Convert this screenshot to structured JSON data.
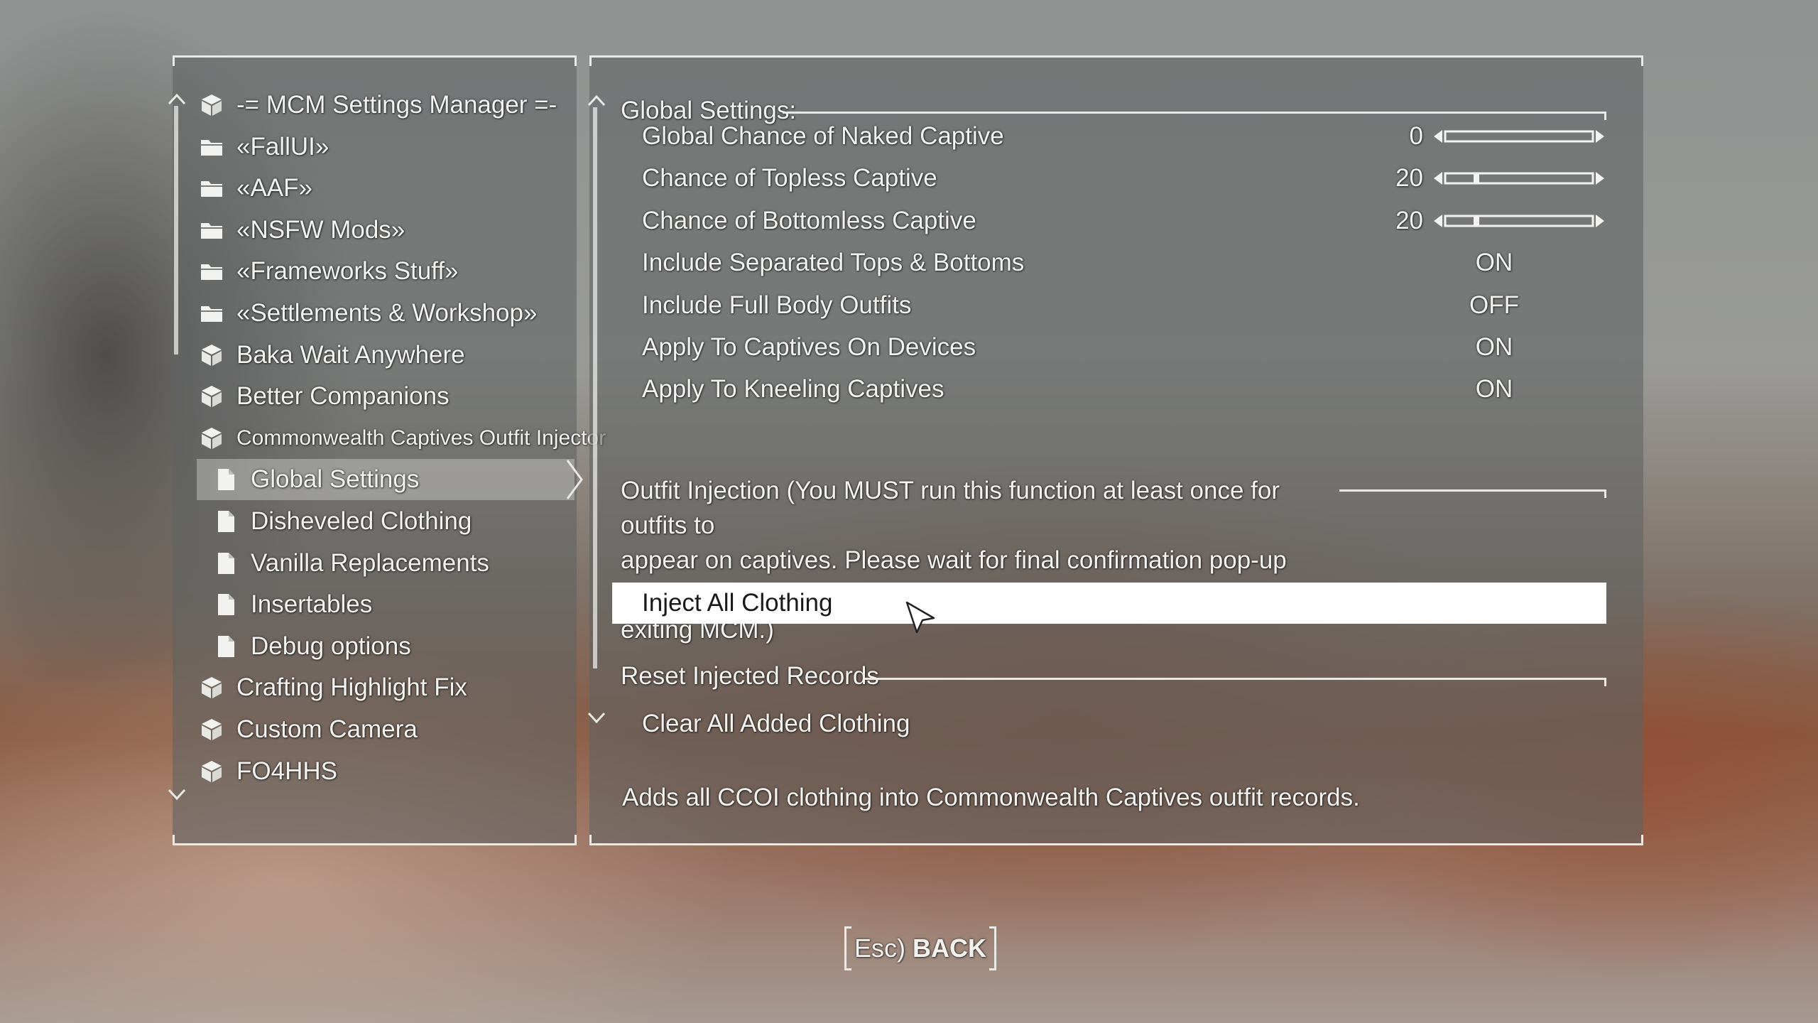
{
  "sidebar": {
    "items": [
      {
        "label": "-= MCM Settings Manager =-",
        "icon": "box-icon"
      },
      {
        "label": "«FallUI»",
        "icon": "folder-icon"
      },
      {
        "label": "«AAF»",
        "icon": "folder-icon"
      },
      {
        "label": "«NSFW Mods»",
        "icon": "folder-icon"
      },
      {
        "label": "«Frameworks Stuff»",
        "icon": "folder-icon"
      },
      {
        "label": "«Settlements & Workshop»",
        "icon": "folder-icon"
      },
      {
        "label": "Baka Wait Anywhere",
        "icon": "box-icon"
      },
      {
        "label": "Better Companions",
        "icon": "box-icon"
      },
      {
        "label": "Commonwealth Captives Outfit Injector",
        "icon": "box-icon"
      },
      {
        "label": "Global Settings",
        "icon": "page-icon",
        "selected": true
      },
      {
        "label": "Disheveled Clothing",
        "icon": "page-icon"
      },
      {
        "label": "Vanilla Replacements",
        "icon": "page-icon"
      },
      {
        "label": "Insertables",
        "icon": "page-icon"
      },
      {
        "label": "Debug options",
        "icon": "page-icon"
      },
      {
        "label": "Crafting Highlight Fix",
        "icon": "box-icon"
      },
      {
        "label": "Custom Camera",
        "icon": "box-icon"
      },
      {
        "label": "FO4HHS",
        "icon": "box-icon"
      }
    ]
  },
  "settings": {
    "global_header": "Global Settings:",
    "options": [
      {
        "label": "Global Chance of Naked Captive",
        "type": "slider",
        "value": "0",
        "level": 0.0
      },
      {
        "label": "Chance of Topless Captive",
        "type": "slider",
        "value": "20",
        "level": 0.2
      },
      {
        "label": "Chance of Bottomless Captive",
        "type": "slider",
        "value": "20",
        "level": 0.2
      },
      {
        "label": "Include Separated Tops & Bottoms",
        "type": "toggle",
        "value": "ON"
      },
      {
        "label": "Include Full Body Outfits",
        "type": "toggle",
        "value": "OFF"
      },
      {
        "label": "Apply To Captives On Devices",
        "type": "toggle",
        "value": "ON"
      },
      {
        "label": "Apply To Kneeling Captives",
        "type": "toggle",
        "value": "ON"
      }
    ],
    "injection_header_lines": [
      "Outfit Injection (You MUST run this function at least once for outfits to",
      "appear on captives.  Please wait for final confirmation pop-up before",
      "exiting MCM.)"
    ],
    "inject_button": "Inject All Clothing",
    "reset_header": "Reset Injected Records",
    "clear_button": "Clear All Added Clothing",
    "description": "Adds all CCOI clothing into Commonwealth Captives outfit records."
  },
  "footer": {
    "back_key": "Esc)",
    "back_label": "BACK"
  }
}
